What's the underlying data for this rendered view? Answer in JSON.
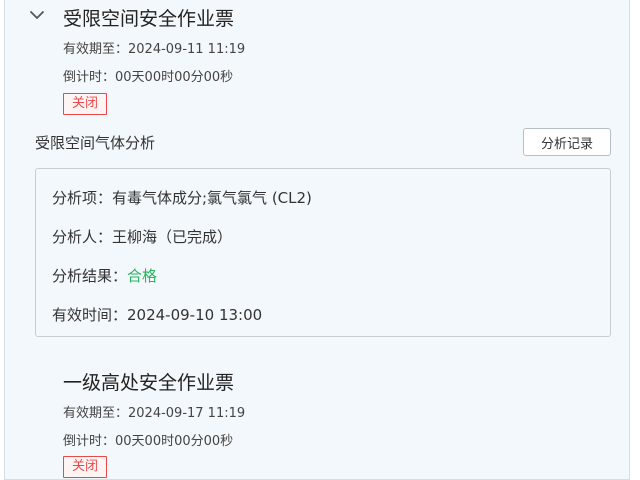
{
  "ticket1": {
    "title": "受限空间安全作业票",
    "expiry": "有效期至：2024-09-11 11:19",
    "countdown": "倒计时：00天00时00分00秒",
    "status": "关闭",
    "icon": "chevron-down-icon"
  },
  "gas_analysis": {
    "title": "受限空间气体分析",
    "records_button": "分析记录",
    "item": "分析项：有毒气体成分;氯气氯气 (CL2)",
    "analyst": "分析人：王柳海（已完成）",
    "result_label": "分析结果：",
    "result_value": "合格",
    "valid_time": "有效时间：2024-09-10 13:00"
  },
  "ticket2": {
    "title": "一级高处安全作业票",
    "expiry": "有效期至：2024-09-17 11:19",
    "countdown": "倒计时：00天00时00分00秒",
    "status": "关闭"
  },
  "colors": {
    "closed": "#e84a4a",
    "pass": "#27b35a",
    "panel_bg": "#f3f8fc"
  }
}
